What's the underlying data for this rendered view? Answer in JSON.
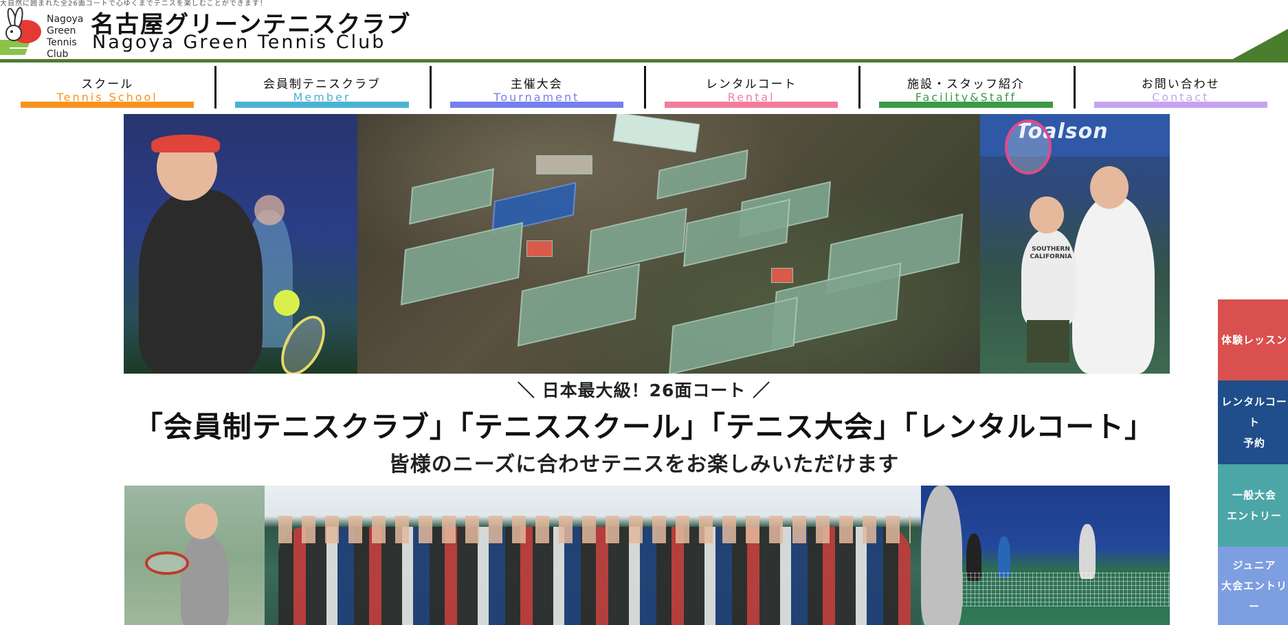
{
  "header": {
    "tagline": "大自然に囲まれた全26面コートで心ゆくまでテニスを楽しむことができます！",
    "logo_lines": [
      "Nagoya",
      "Green",
      "Tennis",
      "Club"
    ],
    "title_jp": "名古屋グリーンテニスクラブ",
    "title_en": "Nagoya Green Tennis Club",
    "accent_color": "#4b7d2e"
  },
  "nav": [
    {
      "jp": "スクール",
      "en": "Tennis School",
      "color": "#f7931e"
    },
    {
      "jp": "会員制テニスクラブ",
      "en": "Member",
      "color": "#4bb3d3"
    },
    {
      "jp": "主催大会",
      "en": "Tournament",
      "color": "#7480ec"
    },
    {
      "jp": "レンタルコート",
      "en": "Rental",
      "color": "#f27c9a"
    },
    {
      "jp": "施設・スタッフ紹介",
      "en": "Facility&Staff",
      "color": "#3a9a44"
    },
    {
      "jp": "お問い合わせ",
      "en": "Contact",
      "color": "#c5a3f0"
    }
  ],
  "hero": {
    "banner_text": "Toalson",
    "shirt_text": "SOUTHERN CALIFORNIA"
  },
  "headline": {
    "sub1": "＼ 日本最大級！26面コート ／",
    "sub2": "「会員制テニスクラブ」「テニススクール」「テニス大会」「レンタルコート」",
    "sub3": "皆様のニーズに合わせテニスをお楽しみいただけます"
  },
  "side_tabs": [
    {
      "lines": [
        "体験レッスン"
      ],
      "color": "#d9504f"
    },
    {
      "lines": [
        "レンタルコート",
        "予約"
      ],
      "color": "#1f4e8a"
    },
    {
      "lines": [
        "一般大会",
        "エントリー"
      ],
      "color": "#4ca6a8"
    },
    {
      "lines": [
        "ジュニア",
        "大会エントリー"
      ],
      "color": "#7d9ee0"
    }
  ]
}
